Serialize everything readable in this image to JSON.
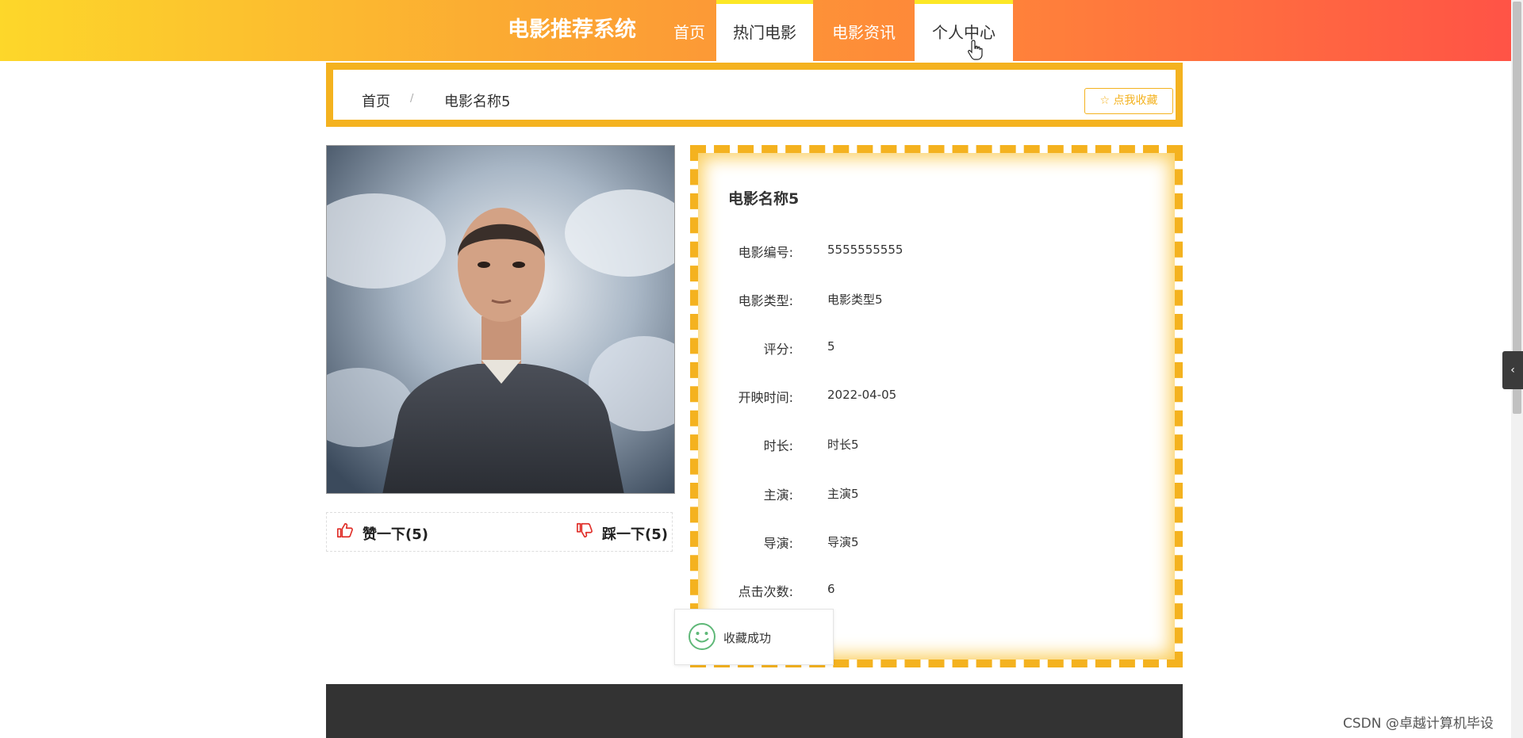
{
  "header": {
    "brand": "电影推荐系统",
    "nav": [
      {
        "label": "首页"
      },
      {
        "label": "热门电影"
      },
      {
        "label": "电影资讯"
      },
      {
        "label": "个人中心"
      }
    ]
  },
  "breadcrumb": {
    "home": "首页",
    "separator": "/",
    "current": "电影名称5",
    "favorite_label": "☆ 点我收藏"
  },
  "poster": {
    "icon": "movie-poster-image"
  },
  "votes": {
    "like": "赞一下(5)",
    "dislike": "踩一下(5)"
  },
  "detail": {
    "title": "电影名称5",
    "rows": [
      {
        "label": "电影编号:",
        "value": "5555555555"
      },
      {
        "label": "电影类型:",
        "value": "电影类型5"
      },
      {
        "label": "评分:",
        "value": "5"
      },
      {
        "label": "开映时间:",
        "value": "2022-04-05"
      },
      {
        "label": "时长:",
        "value": "时长5"
      },
      {
        "label": "主演:",
        "value": "主演5"
      },
      {
        "label": "导演:",
        "value": "导演5"
      },
      {
        "label": "点击次数:",
        "value": "6"
      }
    ]
  },
  "toast": {
    "message": "收藏成功",
    "icon": "smile-icon"
  },
  "side_tab": {
    "label": "‹"
  },
  "watermark": "CSDN @卓越计算机毕设",
  "colors": {
    "accent": "#f4b21f",
    "header_start": "#fdd72a",
    "header_end": "#ff5346",
    "footer": "#333333"
  }
}
